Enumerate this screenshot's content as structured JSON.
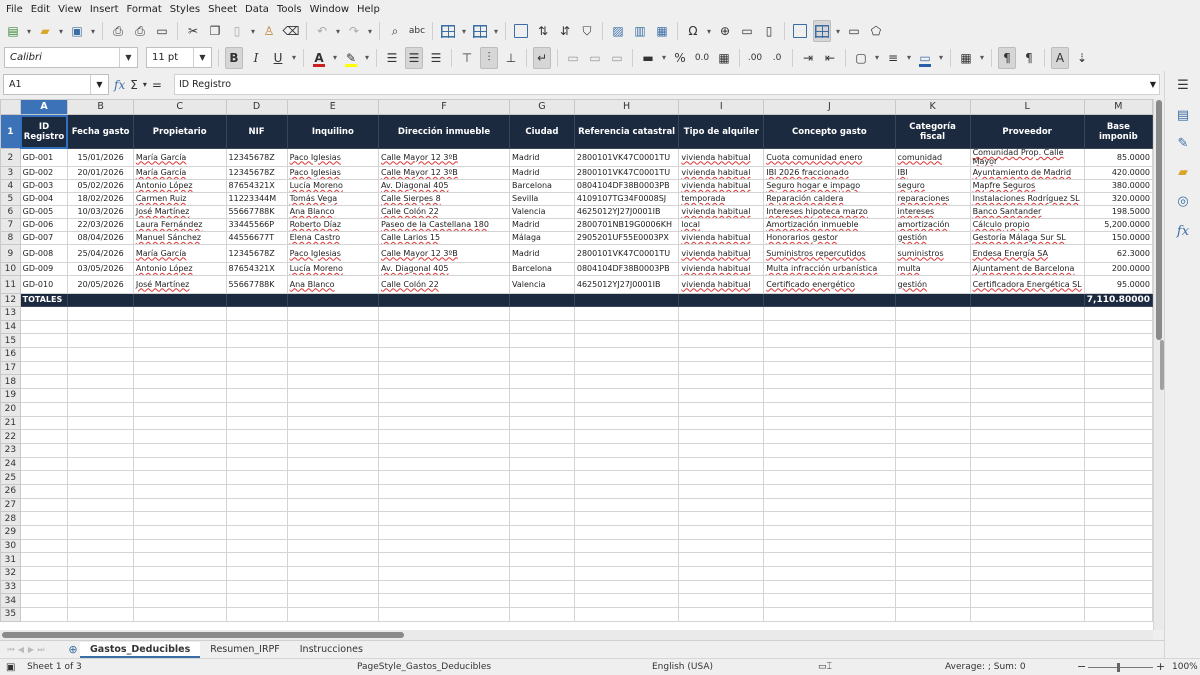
{
  "menu": [
    "File",
    "Edit",
    "View",
    "Insert",
    "Format",
    "Styles",
    "Sheet",
    "Data",
    "Tools",
    "Window",
    "Help"
  ],
  "format_toolbar": {
    "font_name": "Calibri",
    "font_size": "11 pt",
    "bold": "B",
    "italic": "I",
    "underline": "U",
    "font_color": "A",
    "percent": "%",
    "decimal": "0.0",
    "add_decimal": ".00",
    "remove_decimal": ".0"
  },
  "formula_bar": {
    "cell_ref": "A1",
    "content": "ID Registro"
  },
  "columns": [
    "A",
    "B",
    "C",
    "D",
    "E",
    "F",
    "G",
    "H",
    "I",
    "J",
    "K",
    "L",
    "M"
  ],
  "headers": [
    "ID Registro",
    "Fecha gasto",
    "Propietario",
    "NIF",
    "Inquilino",
    "Dirección inmueble",
    "Ciudad",
    "Referencia catastral",
    "Tipo de alquiler",
    "Concepto gasto",
    "Categoría fiscal",
    "Proveedor",
    "Base imponib"
  ],
  "rows": [
    [
      "GD-001",
      "15/01/2026",
      "María García",
      "12345678Z",
      "Paco Iglesias",
      "Calle Mayor 12 3ºB",
      "Madrid",
      "2800101VK47C0001TU",
      "vivienda habitual",
      "Cuota comunidad enero",
      "comunidad",
      "Comunidad Prop. Calle Mayor",
      "85.0000"
    ],
    [
      "GD-002",
      "20/01/2026",
      "María García",
      "12345678Z",
      "Paco Iglesias",
      "Calle Mayor 12 3ºB",
      "Madrid",
      "2800101VK47C0001TU",
      "vivienda habitual",
      "IBI 2026 fraccionado",
      "IBI",
      "Ayuntamiento de Madrid",
      "420.0000"
    ],
    [
      "GD-003",
      "05/02/2026",
      "Antonio López",
      "87654321X",
      "Lucía Moreno",
      "Av. Diagonal 405",
      "Barcelona",
      "0804104DF38B0003PB",
      "vivienda habitual",
      "Seguro hogar e impago",
      "seguro",
      "Mapfre Seguros",
      "380.0000"
    ],
    [
      "GD-004",
      "18/02/2026",
      "Carmen Ruiz",
      "11223344M",
      "Tomás Vega",
      "Calle Sierpes 8",
      "Sevilla",
      "4109107TG34F0008SJ",
      "temporada",
      "Reparación caldera",
      "reparaciones",
      "Instalaciones Rodríguez SL",
      "320.0000"
    ],
    [
      "GD-005",
      "10/03/2026",
      "José Martínez",
      "55667788K",
      "Ana Blanco",
      "Calle Colón 22",
      "Valencia",
      "4625012YJ27J0001IB",
      "vivienda habitual",
      "Intereses hipoteca marzo",
      "intereses",
      "Banco Santander",
      "198.5000"
    ],
    [
      "GD-006",
      "22/03/2026",
      "Laura Fernández",
      "33445566P",
      "Roberto Díaz",
      "Paseo de la Castellana 180",
      "Madrid",
      "2800701NB19G0006KH",
      "local",
      "Amortización inmueble",
      "amortización",
      "Cálculo propio",
      "5,200.0000"
    ],
    [
      "GD-007",
      "08/04/2026",
      "Manuel Sánchez",
      "44556677T",
      "Elena Castro",
      "Calle Larios 15",
      "Málaga",
      "2905201UF55E0003PX",
      "vivienda habitual",
      "Honorarios gestor",
      "gestión",
      "Gestoría Málaga Sur SL",
      "150.0000"
    ],
    [
      "GD-008",
      "25/04/2026",
      "María García",
      "12345678Z",
      "Paco Iglesias",
      "Calle Mayor 12 3ºB",
      "Madrid",
      "2800101VK47C0001TU",
      "vivienda habitual",
      "Suministros repercutidos",
      "suministros",
      "Endesa Energía SA",
      "62.3000"
    ],
    [
      "GD-009",
      "03/05/2026",
      "Antonio López",
      "87654321X",
      "Lucía Moreno",
      "Av. Diagonal 405",
      "Barcelona",
      "0804104DF38B0003PB",
      "vivienda habitual",
      "Multa infracción urbanística",
      "multa",
      "Ajuntament de Barcelona",
      "200.0000"
    ],
    [
      "GD-010",
      "20/05/2026",
      "José Martínez",
      "55667788K",
      "Ana Blanco",
      "Calle Colón 22",
      "Valencia",
      "4625012YJ27J0001IB",
      "vivienda habitual",
      "Certificado energético",
      "gestión",
      "Certificadora Energética SL",
      "95.0000"
    ]
  ],
  "totals": {
    "label": "TOTALES",
    "value": "7,110.80000"
  },
  "row_numbers": [
    "1",
    "2",
    "3",
    "4",
    "5",
    "6",
    "7",
    "8",
    "9",
    "10",
    "11",
    "12",
    "13",
    "14",
    "15",
    "16",
    "17",
    "18",
    "19",
    "20",
    "21",
    "22",
    "23",
    "24",
    "25",
    "26",
    "27",
    "28",
    "29",
    "30",
    "31",
    "32",
    "33",
    "34",
    "35"
  ],
  "tabs": [
    "Gastos_Deducibles",
    "Resumen_IRPF",
    "Instrucciones"
  ],
  "active_tab": "Gastos_Deducibles",
  "status": {
    "sheet": "Sheet 1 of 3",
    "page_style": "PageStyle_Gastos_Deducibles",
    "language": "English (USA)",
    "summary": "Average: ; Sum: 0",
    "zoom": "100%",
    "zoom_minus": "−",
    "zoom_plus": "+"
  },
  "colors": {
    "header_bg": "#1c2a40",
    "selection": "#3c73b8",
    "accent": "#3a6ea5"
  }
}
